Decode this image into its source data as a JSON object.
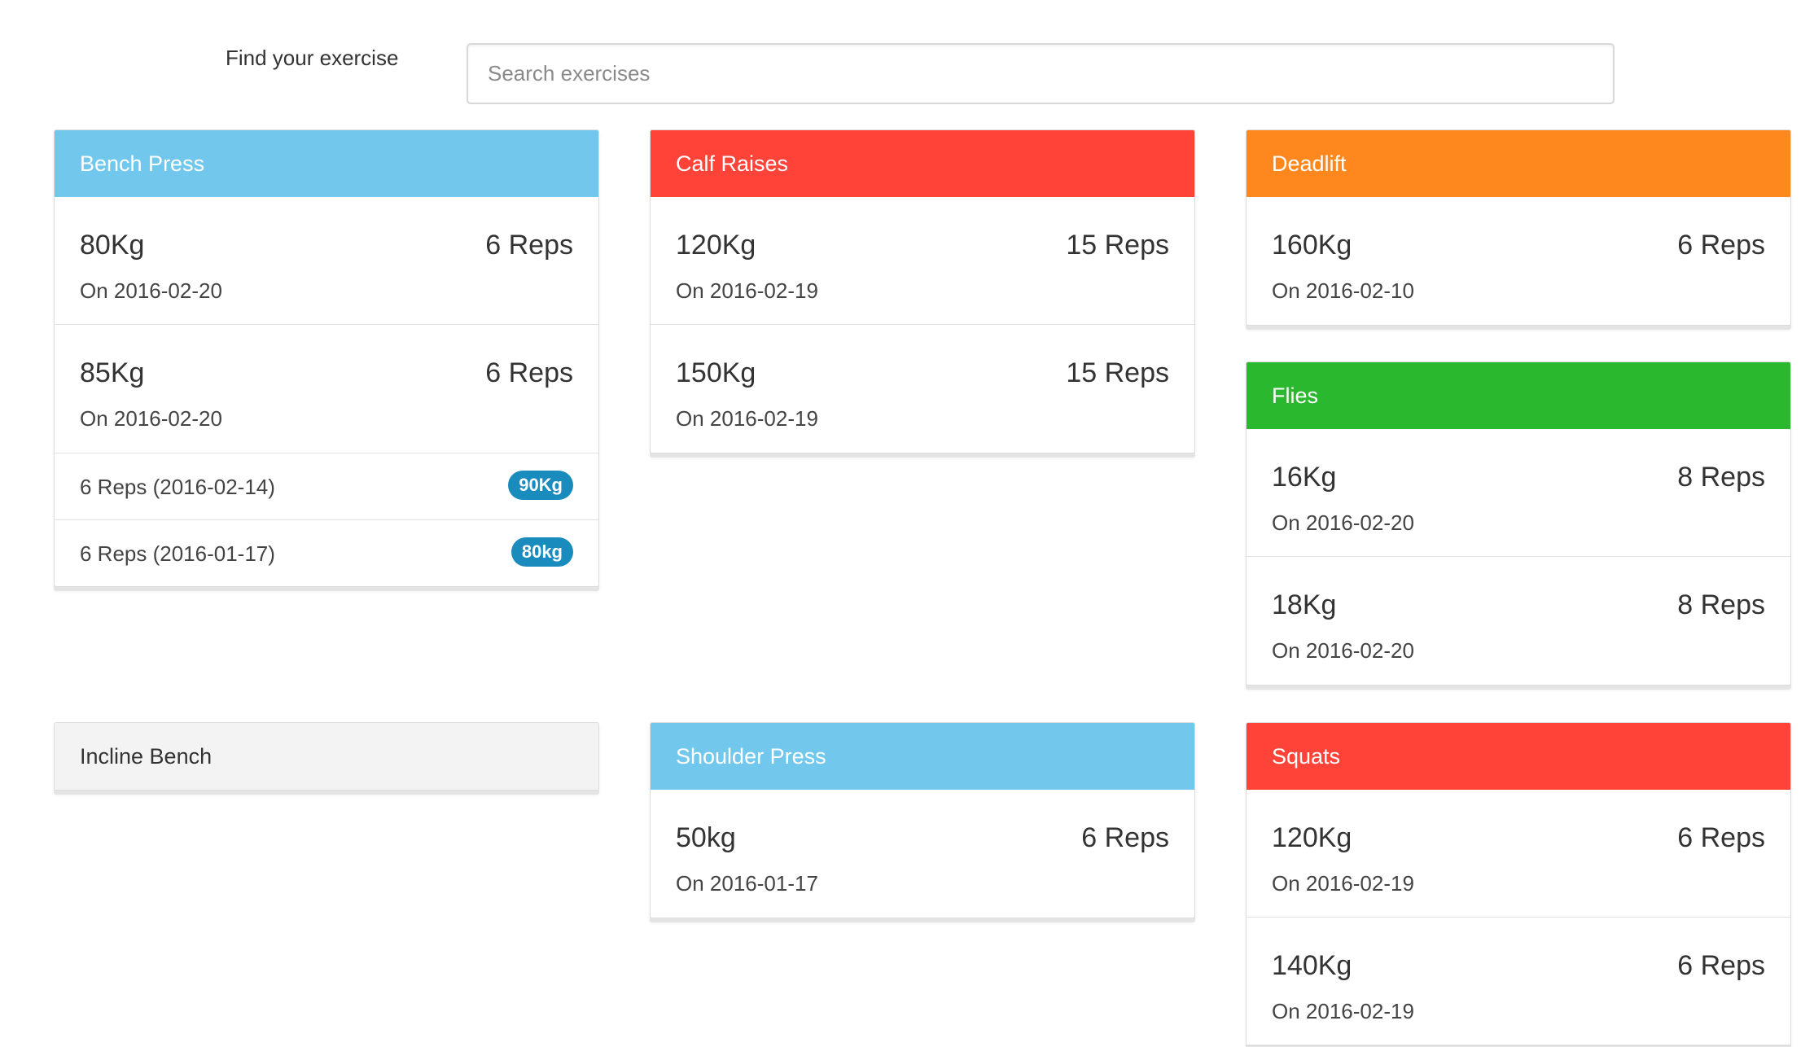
{
  "search": {
    "label": "Find your exercise",
    "placeholder": "Search exercises",
    "value": ""
  },
  "colors": {
    "blue": "#72c8ec",
    "red": "#ff4338",
    "orange": "#ff881e",
    "green": "#2ab82e",
    "neutral": "#f3f3f3",
    "badge": "#1a8bbd"
  },
  "exercises": {
    "bench_press": {
      "title": "Bench Press",
      "color": "#72c8ec",
      "entries": [
        {
          "weight": "80Kg",
          "reps": "6 Reps",
          "date": "On 2016-02-20"
        },
        {
          "weight": "85Kg",
          "reps": "6 Reps",
          "date": "On 2016-02-20"
        }
      ],
      "history": [
        {
          "text": "6 Reps (2016-02-14)",
          "badge": "90Kg"
        },
        {
          "text": "6 Reps (2016-01-17)",
          "badge": "80kg"
        }
      ]
    },
    "calf_raises": {
      "title": "Calf Raises",
      "color": "#ff4338",
      "entries": [
        {
          "weight": "120Kg",
          "reps": "15 Reps",
          "date": "On 2016-02-19"
        },
        {
          "weight": "150Kg",
          "reps": "15 Reps",
          "date": "On 2016-02-19"
        }
      ]
    },
    "deadlift": {
      "title": "Deadlift",
      "color": "#ff881e",
      "entries": [
        {
          "weight": "160Kg",
          "reps": "6 Reps",
          "date": "On 2016-02-10"
        }
      ]
    },
    "flies": {
      "title": "Flies",
      "color": "#2ab82e",
      "entries": [
        {
          "weight": "16Kg",
          "reps": "8 Reps",
          "date": "On 2016-02-20"
        },
        {
          "weight": "18Kg",
          "reps": "8 Reps",
          "date": "On 2016-02-20"
        }
      ]
    },
    "incline_bench": {
      "title": "Incline Bench",
      "color": "#f3f3f3"
    },
    "shoulder_press": {
      "title": "Shoulder Press",
      "color": "#72c8ec",
      "entries": [
        {
          "weight": "50kg",
          "reps": "6 Reps",
          "date": "On 2016-01-17"
        }
      ]
    },
    "squats": {
      "title": "Squats",
      "color": "#ff4338",
      "entries": [
        {
          "weight": "120Kg",
          "reps": "6 Reps",
          "date": "On 2016-02-19"
        },
        {
          "weight": "140Kg",
          "reps": "6 Reps",
          "date": "On 2016-02-19"
        }
      ]
    }
  }
}
